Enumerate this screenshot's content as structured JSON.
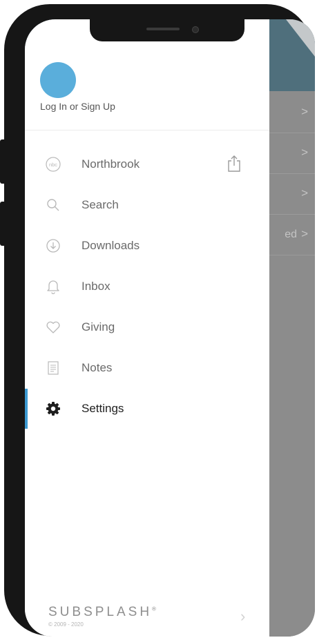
{
  "drawer": {
    "login_label": "Log In or Sign Up",
    "nav_items": [
      {
        "label": "Northbrook",
        "icon": "nbc-logo-icon"
      },
      {
        "label": "Search",
        "icon": "search-icon"
      },
      {
        "label": "Downloads",
        "icon": "download-icon"
      },
      {
        "label": "Inbox",
        "icon": "bell-icon"
      },
      {
        "label": "Giving",
        "icon": "heart-icon"
      },
      {
        "label": "Notes",
        "icon": "notes-icon"
      },
      {
        "label": "Settings",
        "icon": "gear-icon",
        "active": true
      }
    ],
    "logo_text": "nbc",
    "brand": "SUBSPLASH",
    "trademark": "®",
    "copyright": "© 2009 - 2020"
  },
  "background_list": {
    "rows": [
      {
        "text": "",
        "chevron": ">"
      },
      {
        "text": "",
        "chevron": ">"
      },
      {
        "text": "",
        "chevron": ">"
      },
      {
        "text": "ed",
        "chevron": ">"
      }
    ]
  },
  "colors": {
    "avatar": "#5aaedb",
    "active_indicator": "#3c9ad2",
    "header": "#4f6f7c",
    "overlay": "#8c8c8c"
  }
}
